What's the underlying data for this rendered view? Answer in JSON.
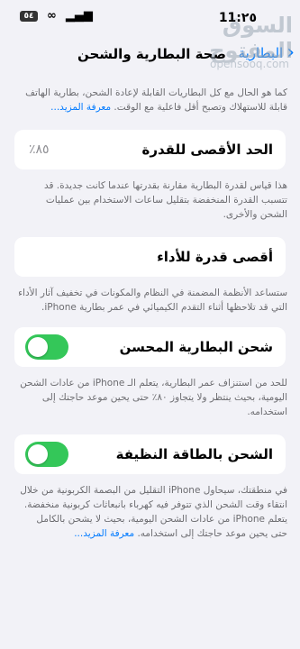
{
  "status_bar": {
    "time": "11:٢٥",
    "battery_label": "٥٤"
  },
  "nav": {
    "back_label": "البطارية",
    "title": "صحة البطارية والشحن"
  },
  "watermark": {
    "arabic": "السوق المفتوح",
    "english": "opensooq.com"
  },
  "intro": {
    "text": "كما هو الحال مع كل البطاريات القابلة لإعادة الشحن، بطارية الهاتف قابلة للاستهلاك وتصبح أقل فاعلية مع الوقت.",
    "link": "معرفة المزيد..."
  },
  "max_capacity": {
    "label": "الحد الأقصى للقدرة",
    "value": "٪٨٥",
    "note": "هذا قياس لقدرة البطارية مقارنة بقدرتها عندما كانت جديدة. قد تتسبب القدرة المنخفضة بتقليل ساعات الاستخدام بين عمليات الشحن والأخرى."
  },
  "peak_performance": {
    "label": "أقصى قدرة للأداء",
    "note": "ستساعد الأنظمة المضمنة في النظام والمكونات في تخفيف آثار الأداء التي قد تلاحظها أثناء التقدم الكيميائي في عمر بطارية iPhone."
  },
  "optimized_charging": {
    "label": "شحن البطارية المحسن",
    "enabled": true,
    "note": "للحد من استنزاف عمر البطارية، يتعلم الـ iPhone من عادات الشحن اليومية، بحيث ينتظر ولا يتجاوز ٨٠٪ حتى يحين موعد حاجتك إلى استخدامه."
  },
  "clean_energy": {
    "label": "الشحن بالطاقة النظيفة",
    "enabled": true,
    "note": "في منطقتك، سيحاول iPhone التقليل من البصمة الكربونية من خلال انتقاء وقت الشحن الذي تتوفر فيه كهرباء بانبعاثات كربونية منخفضة. يتعلم iPhone من عادات الشحن اليومية، بحيث لا يشحن بالكامل حتى يحين موعد حاجتك إلى استخدامه.",
    "link": "معرفة المزيد..."
  },
  "colors": {
    "accent": "#007aff",
    "toggle_on": "#34c759",
    "background": "#f2f2f7"
  }
}
